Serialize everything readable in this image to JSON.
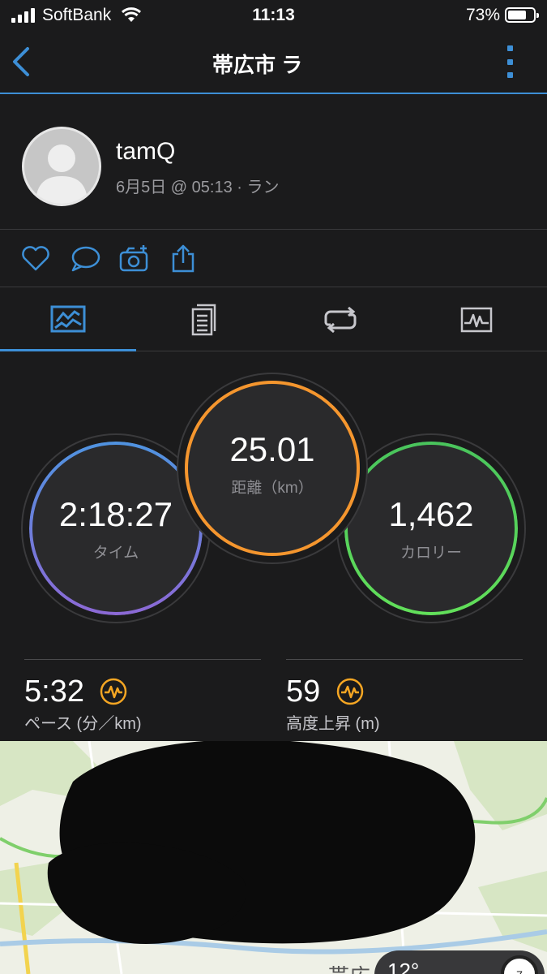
{
  "status_bar": {
    "carrier": "SoftBank",
    "time": "11:13",
    "battery_percent": "73%",
    "battery_level": 0.73
  },
  "nav": {
    "title": "帯広市 ラ"
  },
  "profile": {
    "username": "tamQ",
    "subline": "6月5日 @ 05:13 · ラン"
  },
  "actions": [
    {
      "icon": "heart-icon"
    },
    {
      "icon": "comment-icon"
    },
    {
      "icon": "camera-add-icon"
    },
    {
      "icon": "share-icon"
    }
  ],
  "tabs": [
    {
      "icon": "map-summary-icon",
      "active": true
    },
    {
      "icon": "stats-list-icon",
      "active": false
    },
    {
      "icon": "laps-icon",
      "active": false
    },
    {
      "icon": "charts-icon",
      "active": false
    }
  ],
  "stats": {
    "time": {
      "value": "2:18:27",
      "label": "タイム"
    },
    "distance": {
      "value": "25.01",
      "label": "距離（km）"
    },
    "calories": {
      "value": "1,462",
      "label": "カロリー"
    }
  },
  "metrics": {
    "pace": {
      "value": "5:32",
      "label": "ペース (分／km)"
    },
    "elevation": {
      "value": "59",
      "label": "高度上昇 (m)"
    }
  },
  "map": {
    "place_label": "帯広",
    "weather_temp": "12°",
    "wind_label": "7"
  },
  "colors": {
    "accent": "#3d8fd6",
    "distance_ring": "#f5962e",
    "time_ring_top": "#4f93e0",
    "time_ring_bottom": "#8c69d6",
    "calorie_ring": "#49c45c",
    "metric_icon": "#f5a623"
  }
}
